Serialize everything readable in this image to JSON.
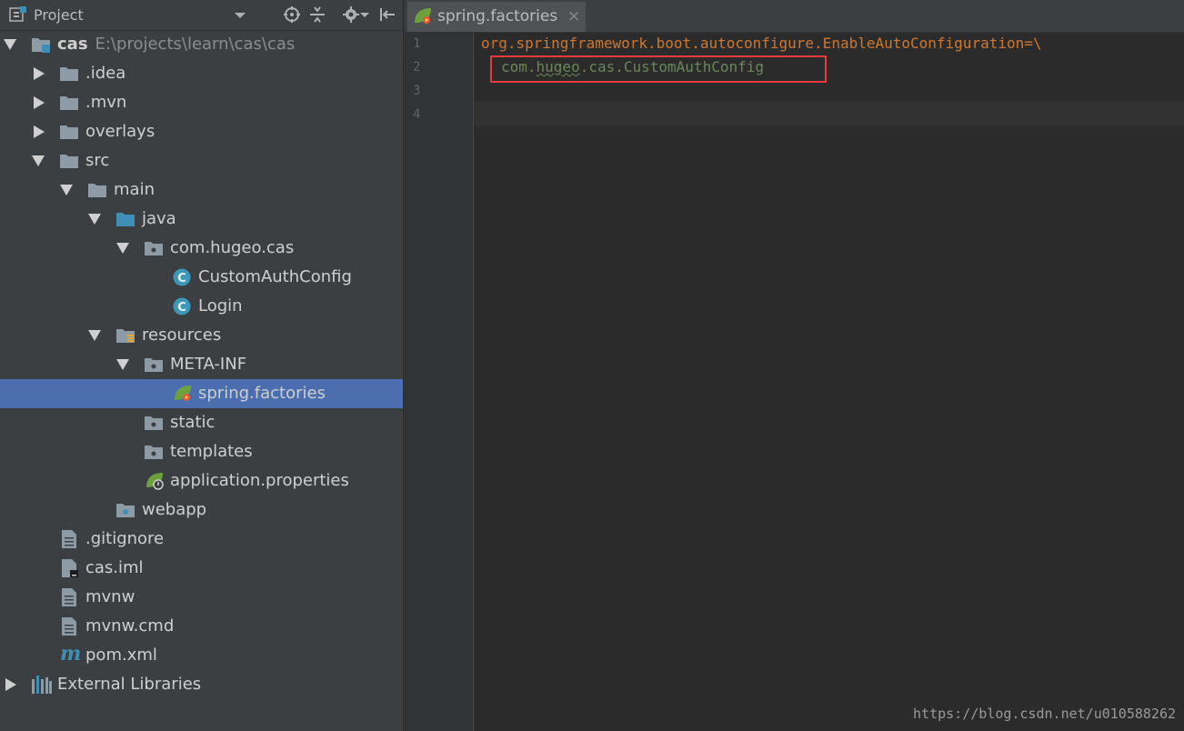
{
  "panel": {
    "title": "Project"
  },
  "tree": {
    "root_name": "cas",
    "root_path": "E:\\projects\\learn\\cas\\cas",
    "items": {
      "idea": ".idea",
      "mvn": ".mvn",
      "overlays": "overlays",
      "src": "src",
      "main": "main",
      "java": "java",
      "package": "com.hugeo.cas",
      "custom_auth": "CustomAuthConfig",
      "login": "Login",
      "resources": "resources",
      "meta_inf": "META-INF",
      "spring_factories": "spring.factories",
      "static": "static",
      "templates": "templates",
      "app_props": "application.properties",
      "webapp": "webapp",
      "gitignore": ".gitignore",
      "cas_iml": "cas.iml",
      "mvnw": "mvnw",
      "mvnw_cmd": "mvnw.cmd",
      "pom": "pom.xml",
      "ext_libs": "External Libraries"
    }
  },
  "editor": {
    "tab_label": "spring.factories",
    "tab_close": "×",
    "lines": [
      "1",
      "2",
      "3",
      "4"
    ],
    "line1": "org.springframework.boot.autoconfigure.EnableAutoConfiguration=\\",
    "line2_prefix": "com.",
    "line2_squiggle": "hugeo",
    "line2_suffix": ".cas.CustomAuthConfig"
  },
  "watermark": "https://blog.csdn.net/u010588262",
  "colors": {
    "panel_bg": "#3c3f41",
    "editor_bg": "#2b2b2b",
    "selection": "#4b6eaf",
    "folder": "#8d9ba6",
    "source_folder": "#3f8eb5",
    "class_icon": "#3d97b8",
    "spring_leaf": "#6ca13c",
    "key_orange": "#cc7832",
    "value_green": "#6a8759",
    "highlight_red": "#e8393c"
  }
}
